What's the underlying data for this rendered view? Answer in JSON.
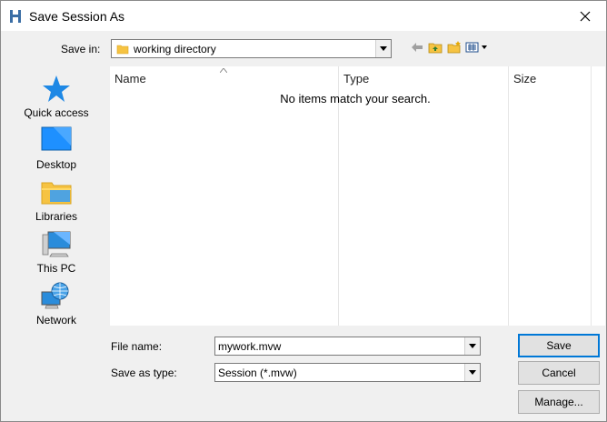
{
  "window": {
    "title": "Save Session As"
  },
  "toolbar": {
    "save_in_label": "Save in:",
    "save_in_value": "working directory"
  },
  "places": [
    {
      "label": "Quick access",
      "icon": "quick-access-star-icon"
    },
    {
      "label": "Desktop",
      "icon": "desktop-icon"
    },
    {
      "label": "Libraries",
      "icon": "libraries-icon"
    },
    {
      "label": "This PC",
      "icon": "this-pc-icon"
    },
    {
      "label": "Network",
      "icon": "network-icon"
    }
  ],
  "filelist": {
    "columns": [
      "Name",
      "Type",
      "Size"
    ],
    "empty_message": "No items match your search."
  },
  "form": {
    "file_name_label": "File name:",
    "file_name_value": "mywork.mvw",
    "save_as_type_label": "Save as type:",
    "save_as_type_value": "Session (*.mvw)"
  },
  "buttons": {
    "save": "Save",
    "cancel": "Cancel",
    "manage": "Manage..."
  },
  "colors": {
    "accent": "#0078d7",
    "star": "#1e88e5",
    "folder": "#f6c342"
  }
}
